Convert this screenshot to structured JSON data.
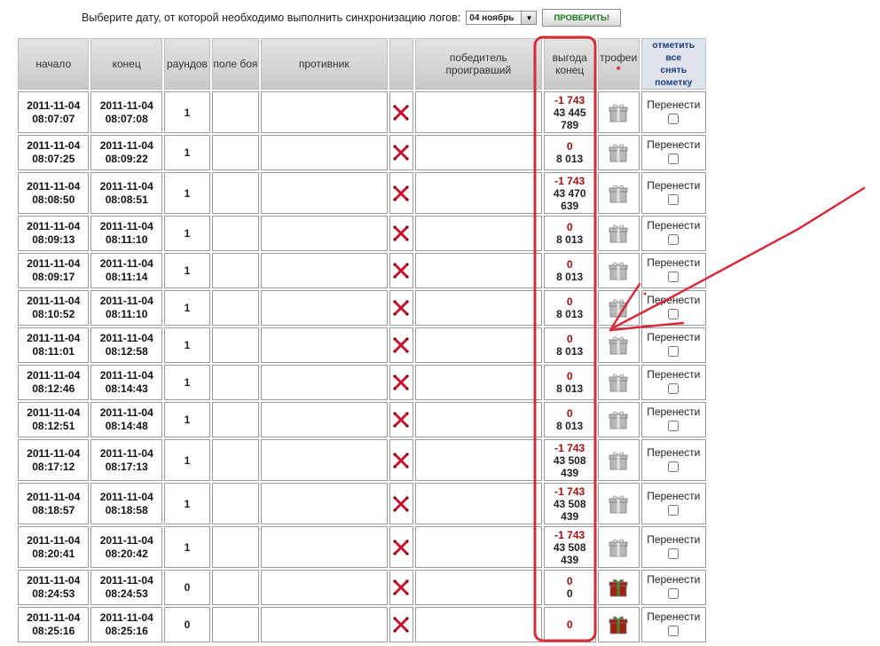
{
  "toolbar": {
    "prompt": "Выберите дату, от которой необходимо выполнить синхронизацию логов:",
    "date_value": "04 ноябрь",
    "check_label": "ПРОВЕРИТЬ!"
  },
  "columns": {
    "start": "начало",
    "end": "конец",
    "rounds": "раундов",
    "field": "поле боя",
    "opponent": "противник",
    "winner": "победитель проигравший",
    "profit": "выгода конец",
    "trophies": "трофеи",
    "trophies_star": "*",
    "mark_all": [
      "отметить",
      "все",
      "снять",
      "пометку"
    ]
  },
  "move_label": "Перенести",
  "rows": [
    {
      "start_date": "2011-11-04",
      "start_time": "08:07:07",
      "end_date": "2011-11-04",
      "end_time": "08:07:08",
      "rounds": "1",
      "profit": "-1 743",
      "end_value": [
        "43 445",
        "789"
      ],
      "trophy": "grey"
    },
    {
      "start_date": "2011-11-04",
      "start_time": "08:07:25",
      "end_date": "2011-11-04",
      "end_time": "08:09:22",
      "rounds": "1",
      "profit": "0",
      "end_value": [
        "8 013"
      ],
      "trophy": "grey"
    },
    {
      "start_date": "2011-11-04",
      "start_time": "08:08:50",
      "end_date": "2011-11-04",
      "end_time": "08:08:51",
      "rounds": "1",
      "profit": "-1 743",
      "end_value": [
        "43 470",
        "639"
      ],
      "trophy": "grey"
    },
    {
      "start_date": "2011-11-04",
      "start_time": "08:09:13",
      "end_date": "2011-11-04",
      "end_time": "08:11:10",
      "rounds": "1",
      "profit": "0",
      "end_value": [
        "8 013"
      ],
      "trophy": "grey"
    },
    {
      "start_date": "2011-11-04",
      "start_time": "08:09:17",
      "end_date": "2011-11-04",
      "end_time": "08:11:14",
      "rounds": "1",
      "profit": "0",
      "end_value": [
        "8 013"
      ],
      "trophy": "grey"
    },
    {
      "start_date": "2011-11-04",
      "start_time": "08:10:52",
      "end_date": "2011-11-04",
      "end_time": "08:11:10",
      "rounds": "1",
      "profit": "0",
      "end_value": [
        "8 013"
      ],
      "trophy": "grey"
    },
    {
      "start_date": "2011-11-04",
      "start_time": "08:11:01",
      "end_date": "2011-11-04",
      "end_time": "08:12:58",
      "rounds": "1",
      "profit": "0",
      "end_value": [
        "8 013"
      ],
      "trophy": "grey"
    },
    {
      "start_date": "2011-11-04",
      "start_time": "08:12:46",
      "end_date": "2011-11-04",
      "end_time": "08:14:43",
      "rounds": "1",
      "profit": "0",
      "end_value": [
        "8 013"
      ],
      "trophy": "grey"
    },
    {
      "start_date": "2011-11-04",
      "start_time": "08:12:51",
      "end_date": "2011-11-04",
      "end_time": "08:14:48",
      "rounds": "1",
      "profit": "0",
      "end_value": [
        "8 013"
      ],
      "trophy": "grey"
    },
    {
      "start_date": "2011-11-04",
      "start_time": "08:17:12",
      "end_date": "2011-11-04",
      "end_time": "08:17:13",
      "rounds": "1",
      "profit": "-1 743",
      "end_value": [
        "43 508",
        "439"
      ],
      "trophy": "grey"
    },
    {
      "start_date": "2011-11-04",
      "start_time": "08:18:57",
      "end_date": "2011-11-04",
      "end_time": "08:18:58",
      "rounds": "1",
      "profit": "-1 743",
      "end_value": [
        "43 508",
        "439"
      ],
      "trophy": "grey"
    },
    {
      "start_date": "2011-11-04",
      "start_time": "08:20:41",
      "end_date": "2011-11-04",
      "end_time": "08:20:42",
      "rounds": "1",
      "profit": "-1 743",
      "end_value": [
        "43 508",
        "439"
      ],
      "trophy": "grey"
    },
    {
      "start_date": "2011-11-04",
      "start_time": "08:24:53",
      "end_date": "2011-11-04",
      "end_time": "08:24:53",
      "rounds": "0",
      "profit": "0",
      "end_value": [
        "0"
      ],
      "trophy": "red"
    },
    {
      "start_date": "2011-11-04",
      "start_time": "08:25:16",
      "end_date": "2011-11-04",
      "end_time": "08:25:16",
      "rounds": "0",
      "profit": "0",
      "end_value": [],
      "trophy": "red"
    }
  ],
  "colors": {
    "annotation": "#d62b3a",
    "negative": "#a01010",
    "mark_all": "#1e3f86",
    "check_btn_text": "#1b7a1b"
  }
}
